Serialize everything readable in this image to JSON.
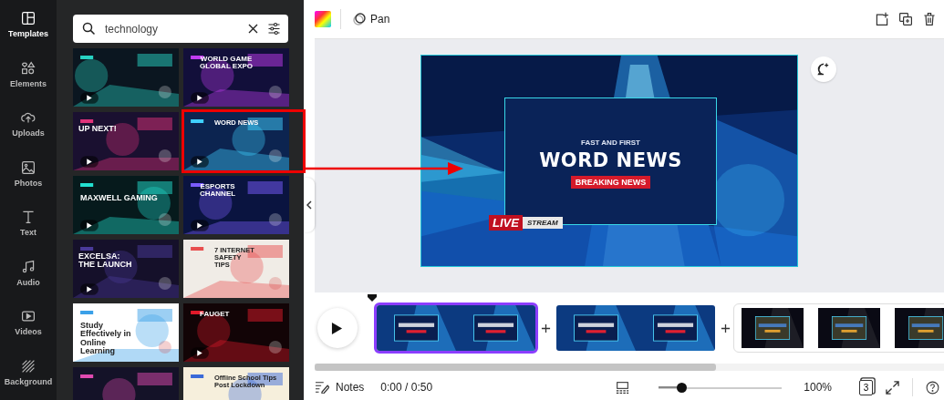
{
  "sidebar": {
    "items": [
      {
        "label": "Templates",
        "selected": true
      },
      {
        "label": "Elements",
        "selected": false
      },
      {
        "label": "Uploads",
        "selected": false
      },
      {
        "label": "Photos",
        "selected": false
      },
      {
        "label": "Text",
        "selected": false
      },
      {
        "label": "Audio",
        "selected": false
      },
      {
        "label": "Videos",
        "selected": false
      },
      {
        "label": "Background",
        "selected": false
      }
    ]
  },
  "search": {
    "value": "technology"
  },
  "templates": [
    {
      "kind": "dark",
      "video": true,
      "highlighted": false
    },
    {
      "kind": "dark",
      "title": [
        "WORLD GAME",
        "GLOBAL EXPO"
      ],
      "video": true,
      "highlighted": false
    },
    {
      "kind": "dark",
      "title": [
        "UP NEXT!"
      ],
      "video": true,
      "highlighted": false
    },
    {
      "kind": "dark",
      "title": [
        "WORD NEWS"
      ],
      "video": true,
      "highlighted": true
    },
    {
      "kind": "dark",
      "title": [
        "MAXWELL GAMING"
      ],
      "video": true,
      "highlighted": false
    },
    {
      "kind": "dark",
      "title": [
        "ESPORTS",
        "CHANNEL"
      ],
      "video": true,
      "highlighted": false
    },
    {
      "kind": "dark",
      "title": [
        "EXCELSA:",
        "THE LAUNCH"
      ],
      "video": true,
      "highlighted": false
    },
    {
      "kind": "light",
      "title": [
        "7 INTERNET",
        "SAFETY",
        "TIPS"
      ],
      "video": false,
      "highlighted": false
    },
    {
      "kind": "light",
      "title": [
        "Study",
        "Effectively in",
        "Online",
        "Learning"
      ],
      "video": false,
      "highlighted": false
    },
    {
      "kind": "dark",
      "title": [
        "FAUGET"
      ],
      "video": true,
      "highlighted": false
    },
    {
      "kind": "dark",
      "highlighted": false
    },
    {
      "kind": "light",
      "title": [
        "Offline School Tips",
        "Post Lockdown"
      ],
      "highlighted": false
    }
  ],
  "toolbar": {
    "tool": "Pan"
  },
  "design": {
    "kicker": "FAST AND FIRST",
    "title": "WORD NEWS",
    "badge": "BREAKING NEWS",
    "live": "LIVE",
    "stream": "STREAM"
  },
  "timeline": {
    "clips": [
      {
        "selected": true
      },
      {
        "selected": false
      },
      {
        "selected": false
      }
    ]
  },
  "footer": {
    "notes": "Notes",
    "time": "0:00 / 0:50",
    "zoom": {
      "level": 0.18
    },
    "zoom_reading": "100%",
    "pages": "3"
  }
}
